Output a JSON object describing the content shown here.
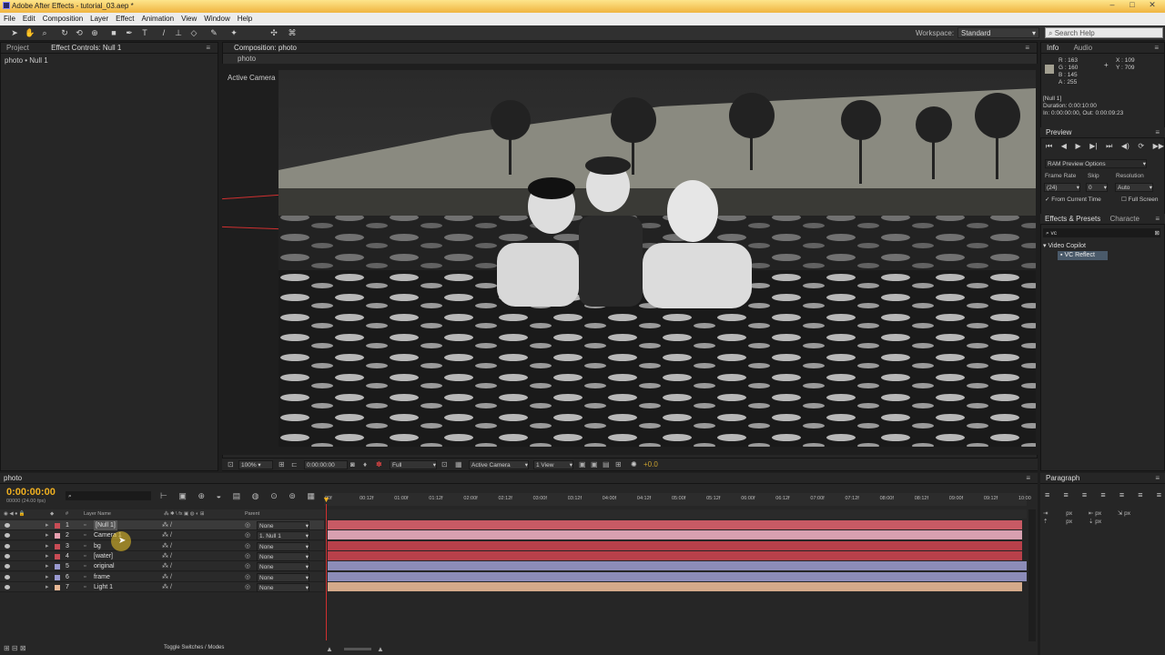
{
  "window": {
    "title": "Adobe After Effects - tutorial_03.aep *"
  },
  "menu": [
    "File",
    "Edit",
    "Composition",
    "Layer",
    "Effect",
    "Animation",
    "View",
    "Window",
    "Help"
  ],
  "toolbar": {
    "workspace_label": "Workspace:",
    "workspace_value": "Standard",
    "search_placeholder": "Search Help"
  },
  "left_panel": {
    "tab_project": "Project",
    "tab_effect_controls": "Effect Controls: Null 1",
    "breadcrumb": "photo • Null 1"
  },
  "comp_panel": {
    "tab": "Composition: photo",
    "subtab": "photo",
    "active_camera_label": "Active Camera"
  },
  "comp_bottom": {
    "zoom": "100%",
    "timecode": "0:00:00:00",
    "resolution": "Full",
    "camera": "Active Camera",
    "views": "1 View",
    "exposure": "+0.0"
  },
  "info_panel": {
    "tab_info": "Info",
    "tab_audio": "Audio",
    "r": "R : 163",
    "g": "G : 160",
    "b": "B : 145",
    "a": "A : 255",
    "x": "X : 109",
    "y": "Y : 709",
    "layer": "[Null 1]",
    "duration": "Duration: 0:00:10:00",
    "inout": "In: 0:00:00:00, Out: 0:00:09:23"
  },
  "preview_panel": {
    "tab": "Preview",
    "ram_options": "RAM Preview Options",
    "frame_rate_label": "Frame Rate",
    "skip_label": "Skip",
    "resolution_label": "Resolution",
    "frame_rate": "(24)",
    "skip": "0",
    "resolution": "Auto",
    "from_current": "From Current Time",
    "full_screen": "Full Screen"
  },
  "effects_panel": {
    "tab": "Effects & Presets",
    "tab2": "Characte",
    "search": "vc",
    "category": "Video Copilot",
    "item": "VC Reflect"
  },
  "timeline": {
    "tab": "photo",
    "timecode": "0:00:00:00",
    "fps": "00000 (24.00 fps)",
    "col_layer_name": "Layer Name",
    "col_parent": "Parent",
    "toggle_label": "Toggle Switches / Modes",
    "ruler": [
      "00f",
      "00:12f",
      "01:00f",
      "01:12f",
      "02:00f",
      "02:12f",
      "03:00f",
      "03:12f",
      "04:00f",
      "04:12f",
      "05:00f",
      "05:12f",
      "06:00f",
      "06:12f",
      "07:00f",
      "07:12f",
      "08:00f",
      "08:12f",
      "09:00f",
      "09:12f",
      "10:00"
    ],
    "layers": [
      {
        "num": "1",
        "name": "[Null 1]",
        "parent": "None",
        "color": "#c84c55",
        "bar": "#c85a64"
      },
      {
        "num": "2",
        "name": "Camera 1",
        "parent": "1. Null 1",
        "color": "#e8a0b0",
        "bar": "#d8a0b0"
      },
      {
        "num": "3",
        "name": "bg",
        "parent": "None",
        "color": "#c84c55",
        "bar": "#b8404a"
      },
      {
        "num": "4",
        "name": "[water]",
        "parent": "None",
        "color": "#c84c55",
        "bar": "#b8404a"
      },
      {
        "num": "5",
        "name": "original",
        "parent": "None",
        "color": "#9a9ad0",
        "bar": "#8c8cb8"
      },
      {
        "num": "6",
        "name": "frame",
        "parent": "None",
        "color": "#9a9ad0",
        "bar": "#8c8cb8"
      },
      {
        "num": "7",
        "name": "Light 1",
        "parent": "None",
        "color": "#e8b896",
        "bar": "#d4aa8a"
      }
    ]
  },
  "paragraph_panel": {
    "tab": "Paragraph",
    "px1": "px",
    "px2": "px",
    "px3": "px",
    "px4": "px",
    "px5": "px"
  }
}
